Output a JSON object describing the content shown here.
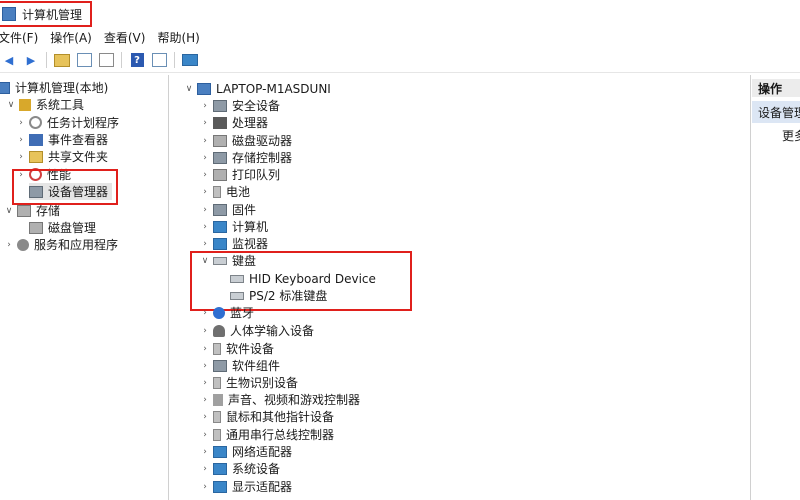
{
  "window": {
    "title": "计算机管理"
  },
  "menu": [
    "文件(F)",
    "操作(A)",
    "查看(V)",
    "帮助(H)"
  ],
  "toolbar": {
    "icons": [
      "back-arrow-icon",
      "forward-arrow-icon",
      "up-folder-icon",
      "show-tree-icon",
      "properties-icon",
      "help-icon",
      "view-icon",
      "monitor-icon"
    ]
  },
  "left_tree": {
    "root": "计算机管理(本地)",
    "system_tools": "系统工具",
    "task_scheduler": "任务计划程序",
    "event_viewer": "事件查看器",
    "shared_folders": "共享文件夹",
    "performance": "性能",
    "device_manager": "设备管理器",
    "storage": "存储",
    "disk_management": "磁盘管理",
    "services": "服务和应用程序"
  },
  "device_tree": {
    "computer": "LAPTOP-M1ASDUNI",
    "categories": [
      {
        "label": "安全设备",
        "icon": "security-device-icon"
      },
      {
        "label": "处理器",
        "icon": "processor-icon"
      },
      {
        "label": "磁盘驱动器",
        "icon": "disk-drive-icon"
      },
      {
        "label": "存储控制器",
        "icon": "storage-controller-icon"
      },
      {
        "label": "打印队列",
        "icon": "printer-icon"
      },
      {
        "label": "电池",
        "icon": "battery-icon"
      },
      {
        "label": "固件",
        "icon": "firmware-icon"
      },
      {
        "label": "计算机",
        "icon": "computer-icon"
      },
      {
        "label": "监视器",
        "icon": "monitor-icon"
      }
    ],
    "keyboard": {
      "label": "键盘",
      "children": [
        "HID Keyboard Device",
        "PS/2 标准键盘"
      ]
    },
    "categories_after": [
      {
        "label": "蓝牙",
        "icon": "bluetooth-icon"
      },
      {
        "label": "人体学输入设备",
        "icon": "hid-icon"
      },
      {
        "label": "软件设备",
        "icon": "software-device-icon"
      },
      {
        "label": "软件组件",
        "icon": "software-component-icon"
      },
      {
        "label": "生物识别设备",
        "icon": "biometric-icon"
      },
      {
        "label": "声音、视频和游戏控制器",
        "icon": "sound-icon"
      },
      {
        "label": "鼠标和其他指针设备",
        "icon": "mouse-icon"
      },
      {
        "label": "通用串行总线控制器",
        "icon": "usb-icon"
      },
      {
        "label": "网络适配器",
        "icon": "network-icon"
      },
      {
        "label": "系统设备",
        "icon": "system-device-icon"
      },
      {
        "label": "显示适配器",
        "icon": "display-adapter-icon"
      }
    ]
  },
  "actions_pane": {
    "header": "操作",
    "selected": "设备管理",
    "more": "更多"
  },
  "colors": {
    "highlight_box": "#e0201c",
    "selection": "#dce6f4"
  }
}
